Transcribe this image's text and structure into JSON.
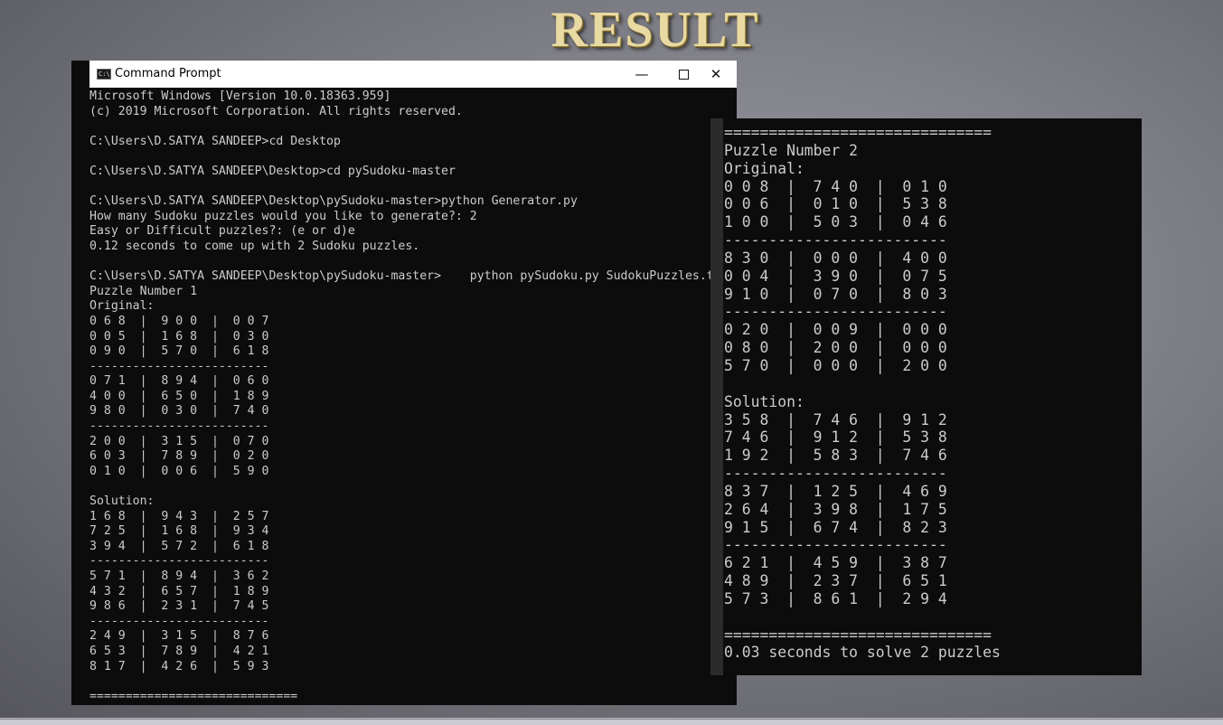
{
  "heading": "RESULT",
  "window": {
    "icon_text": "C:\\.",
    "title": "Command Prompt",
    "minimize_glyph": "—",
    "close_glyph": "✕",
    "console_text": "Microsoft Windows [Version 10.0.18363.959]\n(c) 2019 Microsoft Corporation. All rights reserved.\n\nC:\\Users\\D.SATYA SANDEEP>cd Desktop\n\nC:\\Users\\D.SATYA SANDEEP\\Desktop>cd pySudoku-master\n\nC:\\Users\\D.SATYA SANDEEP\\Desktop\\pySudoku-master>python Generator.py\nHow many Sudoku puzzles would you like to generate?: 2\nEasy or Difficult puzzles?: (e or d)e\n0.12 seconds to come up with 2 Sudoku puzzles.\n\nC:\\Users\\D.SATYA SANDEEP\\Desktop\\pySudoku-master>    python pySudoku.py SudokuPuzzles.txt\nPuzzle Number 1\nOriginal:\n0 6 8  |  9 0 0  |  0 0 7\n0 0 5  |  1 6 8  |  0 3 0\n0 9 0  |  5 7 0  |  6 1 8\n-------------------------\n0 7 1  |  8 9 4  |  0 6 0\n4 0 0  |  6 5 0  |  1 8 9\n9 8 0  |  0 3 0  |  7 4 0\n-------------------------\n2 0 0  |  3 1 5  |  0 7 0\n6 0 3  |  7 8 9  |  0 2 0\n0 1 0  |  0 0 6  |  5 9 0\n\nSolution:\n1 6 8  |  9 4 3  |  2 5 7\n7 2 5  |  1 6 8  |  9 3 4\n3 9 4  |  5 7 2  |  6 1 8\n-------------------------\n5 7 1  |  8 9 4  |  3 6 2\n4 3 2  |  6 5 7  |  1 8 9\n9 8 6  |  2 3 1  |  7 4 5\n-------------------------\n2 4 9  |  3 1 5  |  8 7 6\n6 5 3  |  7 8 9  |  4 2 1\n8 1 7  |  4 2 6  |  5 9 3\n\n============================="
  },
  "second_output": {
    "console_text": "==============================\nPuzzle Number 2\nOriginal:\n0 0 8  |  7 4 0  |  0 1 0\n0 0 6  |  0 1 0  |  5 3 8\n1 0 0  |  5 0 3  |  0 4 6\n-------------------------\n8 3 0  |  0 0 0  |  4 0 0\n0 0 4  |  3 9 0  |  0 7 5\n9 1 0  |  0 7 0  |  8 0 3\n-------------------------\n0 2 0  |  0 0 9  |  0 0 0\n0 8 0  |  2 0 0  |  0 0 0\n5 7 0  |  0 0 0  |  2 0 0\n\nSolution:\n3 5 8  |  7 4 6  |  9 1 2\n7 4 6  |  9 1 2  |  5 3 8\n1 9 2  |  5 8 3  |  7 4 6\n-------------------------\n8 3 7  |  1 2 5  |  4 6 9\n2 6 4  |  3 9 8  |  1 7 5\n9 1 5  |  6 7 4  |  8 2 3\n-------------------------\n6 2 1  |  4 5 9  |  3 8 7\n4 8 9  |  2 3 7  |  6 5 1\n5 7 3  |  8 6 1  |  2 9 4\n\n==============================\n0.03 seconds to solve 2 puzzles"
  }
}
